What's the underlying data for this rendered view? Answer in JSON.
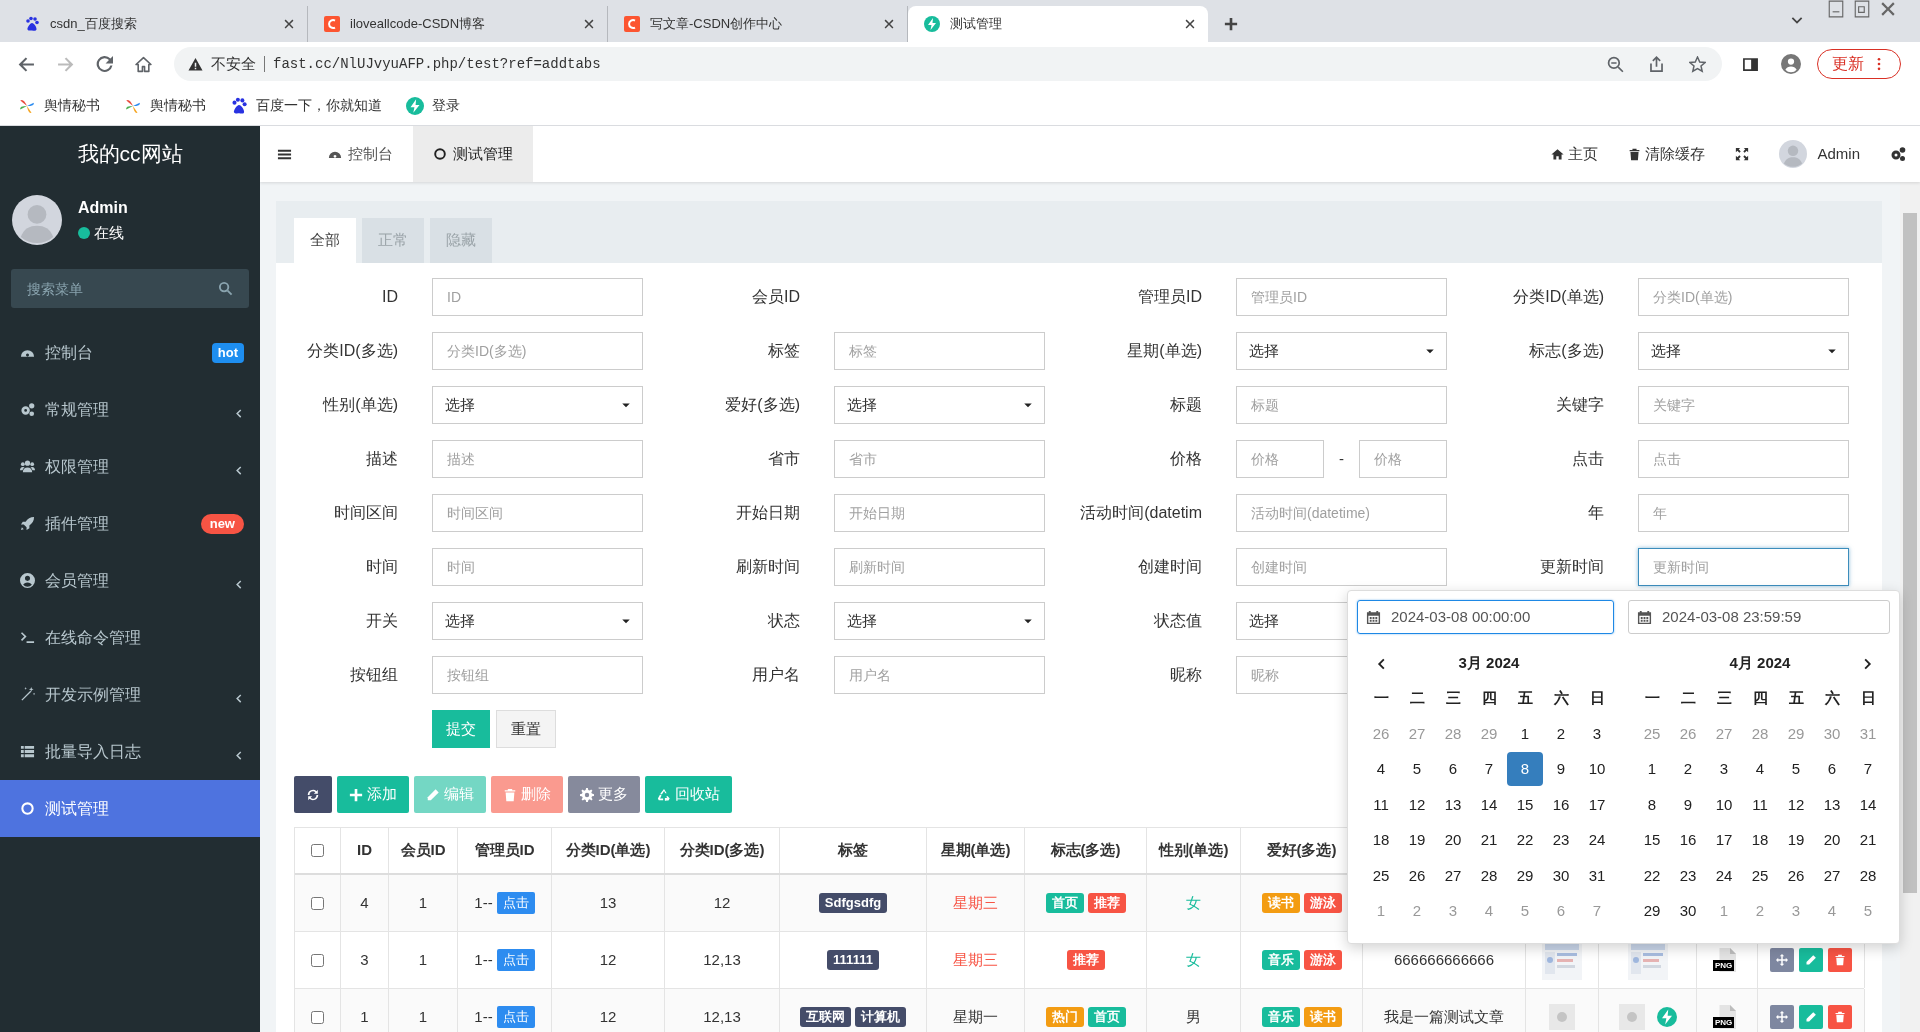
{
  "browser": {
    "tabs": [
      {
        "title": "csdn_百度搜索",
        "kind": "paw",
        "selected": false
      },
      {
        "title": "iloveallcode-CSDN博客",
        "kind": "csdn",
        "selected": false
      },
      {
        "title": "写文章-CSDN创作中心",
        "kind": "csdn",
        "selected": false
      },
      {
        "title": "测试管理",
        "kind": "bolt",
        "selected": true
      }
    ],
    "security": "不安全",
    "url": "fast.cc/NlUJvyuAFP.php/test?ref=addtabs",
    "update_button": "更新",
    "bookmarks": [
      {
        "label": "舆情秘书",
        "kind": "pinwheel"
      },
      {
        "label": "舆情秘书",
        "kind": "pinwheel"
      },
      {
        "label": "百度一下，你就知道",
        "kind": "paw"
      },
      {
        "label": "登录",
        "kind": "bolt"
      }
    ]
  },
  "sidebar": {
    "title": "我的cc网站",
    "user": {
      "name": "Admin",
      "status": "在线"
    },
    "search": {
      "placeholder": "搜索菜单"
    },
    "items": [
      {
        "label": "控制台",
        "kind": "dashboard",
        "badge": {
          "text": "hot",
          "color": "#1e8ef0"
        },
        "expandable": false,
        "selected": false
      },
      {
        "label": "常规管理",
        "kind": "cogs",
        "expandable": true,
        "selected": false
      },
      {
        "label": "权限管理",
        "kind": "users",
        "expandable": true,
        "selected": false
      },
      {
        "label": "插件管理",
        "kind": "rocket",
        "badge": {
          "text": "new",
          "color": "#f75444"
        },
        "expandable": false,
        "selected": false
      },
      {
        "label": "会员管理",
        "kind": "usercircle",
        "expandable": true,
        "selected": false
      },
      {
        "label": "在线命令管理",
        "kind": "terminal",
        "expandable": false,
        "selected": false
      },
      {
        "label": "开发示例管理",
        "kind": "magic",
        "expandable": true,
        "selected": false
      },
      {
        "label": "批量导入日志",
        "kind": "list",
        "expandable": true,
        "selected": false
      },
      {
        "label": "测试管理",
        "kind": "circle",
        "expandable": false,
        "selected": true
      }
    ]
  },
  "header": {
    "nav_tabs": [
      {
        "label": "控制台",
        "kind": "dashboard",
        "selected": false
      },
      {
        "label": "测试管理",
        "kind": "circle",
        "selected": true
      }
    ],
    "links": [
      {
        "label": "主页",
        "kind": "home"
      },
      {
        "label": "清除缓存",
        "kind": "trash"
      }
    ],
    "user": "Admin"
  },
  "panel": {
    "tabs": [
      {
        "label": "全部",
        "selected": true
      },
      {
        "label": "正常",
        "selected": false
      },
      {
        "label": "隐藏",
        "selected": false
      }
    ],
    "form": {
      "rows": [
        [
          {
            "label": "ID",
            "kind": "input",
            "placeholder": "ID",
            "focused": false
          },
          {
            "label": "会员ID",
            "kind": "none"
          },
          {
            "label": "管理员ID",
            "kind": "input",
            "placeholder": "管理员ID",
            "focused": false
          },
          {
            "label": "分类ID(单选)",
            "kind": "input",
            "placeholder": "分类ID(单选)",
            "focused": false
          }
        ],
        [
          {
            "label": "分类ID(多选)",
            "kind": "input",
            "placeholder": "分类ID(多选)",
            "focused": false
          },
          {
            "label": "标签",
            "kind": "input",
            "placeholder": "标签",
            "focused": false
          },
          {
            "label": "星期(单选)",
            "kind": "select",
            "value": "选择"
          },
          {
            "label": "标志(多选)",
            "kind": "select",
            "value": "选择"
          }
        ],
        [
          {
            "label": "性别(单选)",
            "kind": "select",
            "value": "选择"
          },
          {
            "label": "爱好(多选)",
            "kind": "select",
            "value": "选择"
          },
          {
            "label": "标题",
            "kind": "input",
            "placeholder": "标题",
            "focused": false
          },
          {
            "label": "关键字",
            "kind": "input",
            "placeholder": "关键字",
            "focused": false
          }
        ],
        [
          {
            "label": "描述",
            "kind": "input",
            "placeholder": "描述",
            "focused": false
          },
          {
            "label": "省市",
            "kind": "input",
            "placeholder": "省市",
            "focused": false
          },
          {
            "label": "价格",
            "kind": "range",
            "placeholder": "价格",
            "placeholder_to": "价格",
            "separator": "-"
          },
          {
            "label": "点击",
            "kind": "input",
            "placeholder": "点击",
            "focused": false
          }
        ],
        [
          {
            "label": "时间区间",
            "kind": "input",
            "placeholder": "时间区间",
            "focused": false
          },
          {
            "label": "开始日期",
            "kind": "input",
            "placeholder": "开始日期",
            "focused": false
          },
          {
            "label": "活动时间(datetim",
            "kind": "input",
            "placeholder": "活动时间(datetime)",
            "focused": false
          },
          {
            "label": "年",
            "kind": "input",
            "placeholder": "年",
            "focused": false
          }
        ],
        [
          {
            "label": "时间",
            "kind": "input",
            "placeholder": "时间",
            "focused": false
          },
          {
            "label": "刷新时间",
            "kind": "input",
            "placeholder": "刷新时间",
            "focused": false
          },
          {
            "label": "创建时间",
            "kind": "input",
            "placeholder": "创建时间",
            "focused": false
          },
          {
            "label": "更新时间",
            "kind": "input",
            "placeholder": "更新时间",
            "focused": true
          }
        ],
        [
          {
            "label": "开关",
            "kind": "select",
            "value": "选择"
          },
          {
            "label": "状态",
            "kind": "select",
            "value": "选择"
          },
          {
            "label": "状态值",
            "kind": "select",
            "value": "选择"
          }
        ],
        [
          {
            "label": "按钮组",
            "kind": "input",
            "placeholder": "按钮组",
            "focused": false
          },
          {
            "label": "用户名",
            "kind": "input",
            "placeholder": "用户名",
            "focused": false
          },
          {
            "label": "昵称",
            "kind": "input",
            "placeholder": "昵称",
            "focused": false
          }
        ]
      ],
      "submit": "提交",
      "reset": "重置"
    },
    "toolbar": [
      {
        "kind": "refresh",
        "disabled": false
      },
      {
        "kind": "add",
        "label": "添加",
        "disabled": false
      },
      {
        "kind": "edit",
        "label": "编辑",
        "disabled": true
      },
      {
        "kind": "delete",
        "label": "删除",
        "disabled": true
      },
      {
        "kind": "more",
        "label": "更多",
        "disabled": false
      },
      {
        "kind": "recycle",
        "label": "回收站",
        "disabled": false
      }
    ],
    "table": {
      "select_all_checked": false,
      "columns": [
        "ID",
        "会员ID",
        "管理员ID",
        "分类ID(单选)",
        "分类ID(多选)",
        "标签",
        "星期(单选)",
        "标志(多选)",
        "性别(单选)",
        "爱好(多选)"
      ],
      "rows": [
        {
          "checked": false,
          "id": "4",
          "member_id": "1",
          "admin_id": "1--",
          "admin_button": "点击",
          "category": "13",
          "categories": "12",
          "tags": [
            "Sdfgsdfg"
          ],
          "weekday": {
            "text": "星期三",
            "color": "#f75444"
          },
          "flags": [
            {
              "text": "首页",
              "color": "#18bc9c"
            },
            {
              "text": "推荐",
              "color": "#f75444"
            }
          ],
          "gender": {
            "text": "女",
            "color": "#18bc9c"
          },
          "hobbies": [
            {
              "text": "读书",
              "color": "#f39c12"
            },
            {
              "text": "游泳",
              "color": "#f75444"
            }
          ]
        },
        {
          "checked": false,
          "id": "3",
          "member_id": "1",
          "admin_id": "1--",
          "admin_button": "点击",
          "category": "12",
          "categories": "12,13",
          "tags": [
            "111111"
          ],
          "weekday": {
            "text": "星期三",
            "color": "#f75444"
          },
          "flags": [
            {
              "text": "推荐",
              "color": "#f75444"
            }
          ],
          "gender": {
            "text": "女",
            "color": "#18bc9c"
          },
          "hobbies": [
            {
              "text": "音乐",
              "color": "#18bc9c"
            },
            {
              "text": "游泳",
              "color": "#f75444"
            }
          ],
          "summary": "666666666666",
          "thumbnails": [
            {
              "kind": "picture"
            },
            {
              "kind": "picture"
            }
          ],
          "file_type": "PNG"
        },
        {
          "checked": false,
          "id": "1",
          "member_id": "1",
          "admin_id": "1--",
          "admin_button": "点击",
          "category": "12",
          "categories": "12,13",
          "tags": [
            "互联网",
            "计算机"
          ],
          "weekday": {
            "text": "星期一",
            "color": "#333333"
          },
          "flags": [
            {
              "text": "热门",
              "color": "#f39c12"
            },
            {
              "text": "首页",
              "color": "#18bc9c"
            }
          ],
          "gender": {
            "text": "男",
            "color": "#333333"
          },
          "hobbies": [
            {
              "text": "音乐",
              "color": "#18bc9c"
            },
            {
              "text": "读书",
              "color": "#f39c12"
            }
          ],
          "summary": "我是一篇测试文章",
          "thumbnails": [
            {
              "kind": "blank"
            },
            {
              "kind": "bolt"
            }
          ],
          "file_type": "PNG"
        }
      ]
    }
  },
  "date_picker": {
    "start": {
      "value": "2024-03-08 00:00:00",
      "focused": true
    },
    "end": {
      "value": "2024-03-08 23:59:59",
      "focused": false
    },
    "months": [
      {
        "title": "3月 2024",
        "weekdays": [
          "一",
          "二",
          "三",
          "四",
          "五",
          "六",
          "日"
        ],
        "days": [
          {
            "text": "26",
            "muted": true,
            "selected": false
          },
          {
            "text": "27",
            "muted": true,
            "selected": false
          },
          {
            "text": "28",
            "muted": true,
            "selected": false
          },
          {
            "text": "29",
            "muted": true,
            "selected": false
          },
          {
            "text": "1",
            "muted": false,
            "selected": false
          },
          {
            "text": "2",
            "muted": false,
            "selected": false
          },
          {
            "text": "3",
            "muted": false,
            "selected": false
          },
          {
            "text": "4",
            "muted": false,
            "selected": false
          },
          {
            "text": "5",
            "muted": false,
            "selected": false
          },
          {
            "text": "6",
            "muted": false,
            "selected": false
          },
          {
            "text": "7",
            "muted": false,
            "selected": false
          },
          {
            "text": "8",
            "muted": false,
            "selected": true
          },
          {
            "text": "9",
            "muted": false,
            "selected": false
          },
          {
            "text": "10",
            "muted": false,
            "selected": false
          },
          {
            "text": "11",
            "muted": false,
            "selected": false
          },
          {
            "text": "12",
            "muted": false,
            "selected": false
          },
          {
            "text": "13",
            "muted": false,
            "selected": false
          },
          {
            "text": "14",
            "muted": false,
            "selected": false
          },
          {
            "text": "15",
            "muted": false,
            "selected": false
          },
          {
            "text": "16",
            "muted": false,
            "selected": false
          },
          {
            "text": "17",
            "muted": false,
            "selected": false
          },
          {
            "text": "18",
            "muted": false,
            "selected": false
          },
          {
            "text": "19",
            "muted": false,
            "selected": false
          },
          {
            "text": "20",
            "muted": false,
            "selected": false
          },
          {
            "text": "21",
            "muted": false,
            "selected": false
          },
          {
            "text": "22",
            "muted": false,
            "selected": false
          },
          {
            "text": "23",
            "muted": false,
            "selected": false
          },
          {
            "text": "24",
            "muted": false,
            "selected": false
          },
          {
            "text": "25",
            "muted": false,
            "selected": false
          },
          {
            "text": "26",
            "muted": false,
            "selected": false
          },
          {
            "text": "27",
            "muted": false,
            "selected": false
          },
          {
            "text": "28",
            "muted": false,
            "selected": false
          },
          {
            "text": "29",
            "muted": false,
            "selected": false
          },
          {
            "text": "30",
            "muted": false,
            "selected": false
          },
          {
            "text": "31",
            "muted": false,
            "selected": false
          },
          {
            "text": "1",
            "muted": true,
            "selected": false
          },
          {
            "text": "2",
            "muted": true,
            "selected": false
          },
          {
            "text": "3",
            "muted": true,
            "selected": false
          },
          {
            "text": "4",
            "muted": true,
            "selected": false
          },
          {
            "text": "5",
            "muted": true,
            "selected": false
          },
          {
            "text": "6",
            "muted": true,
            "selected": false
          },
          {
            "text": "7",
            "muted": true,
            "selected": false
          }
        ]
      },
      {
        "title": "4月 2024",
        "weekdays": [
          "一",
          "二",
          "三",
          "四",
          "五",
          "六",
          "日"
        ],
        "days": [
          {
            "text": "25",
            "muted": true,
            "selected": false
          },
          {
            "text": "26",
            "muted": true,
            "selected": false
          },
          {
            "text": "27",
            "muted": true,
            "selected": false
          },
          {
            "text": "28",
            "muted": true,
            "selected": false
          },
          {
            "text": "29",
            "muted": true,
            "selected": false
          },
          {
            "text": "30",
            "muted": true,
            "selected": false
          },
          {
            "text": "31",
            "muted": true,
            "selected": false
          },
          {
            "text": "1",
            "muted": false,
            "selected": false
          },
          {
            "text": "2",
            "muted": false,
            "selected": false
          },
          {
            "text": "3",
            "muted": false,
            "selected": false
          },
          {
            "text": "4",
            "muted": false,
            "selected": false
          },
          {
            "text": "5",
            "muted": false,
            "selected": false
          },
          {
            "text": "6",
            "muted": false,
            "selected": false
          },
          {
            "text": "7",
            "muted": false,
            "selected": false
          },
          {
            "text": "8",
            "muted": false,
            "selected": false
          },
          {
            "text": "9",
            "muted": false,
            "selected": false
          },
          {
            "text": "10",
            "muted": false,
            "selected": false
          },
          {
            "text": "11",
            "muted": false,
            "selected": false
          },
          {
            "text": "12",
            "muted": false,
            "selected": false
          },
          {
            "text": "13",
            "muted": false,
            "selected": false
          },
          {
            "text": "14",
            "muted": false,
            "selected": false
          },
          {
            "text": "15",
            "muted": false,
            "selected": false
          },
          {
            "text": "16",
            "muted": false,
            "selected": false
          },
          {
            "text": "17",
            "muted": false,
            "selected": false
          },
          {
            "text": "18",
            "muted": false,
            "selected": false
          },
          {
            "text": "19",
            "muted": false,
            "selected": false
          },
          {
            "text": "20",
            "muted": false,
            "selected": false
          },
          {
            "text": "21",
            "muted": false,
            "selected": false
          },
          {
            "text": "22",
            "muted": false,
            "selected": false
          },
          {
            "text": "23",
            "muted": false,
            "selected": false
          },
          {
            "text": "24",
            "muted": false,
            "selected": false
          },
          {
            "text": "25",
            "muted": false,
            "selected": false
          },
          {
            "text": "26",
            "muted": false,
            "selected": false
          },
          {
            "text": "27",
            "muted": false,
            "selected": false
          },
          {
            "text": "28",
            "muted": false,
            "selected": false
          },
          {
            "text": "29",
            "muted": false,
            "selected": false
          },
          {
            "text": "30",
            "muted": false,
            "selected": false
          },
          {
            "text": "1",
            "muted": true,
            "selected": false
          },
          {
            "text": "2",
            "muted": true,
            "selected": false
          },
          {
            "text": "3",
            "muted": true,
            "selected": false
          },
          {
            "text": "4",
            "muted": true,
            "selected": false
          },
          {
            "text": "5",
            "muted": true,
            "selected": false
          }
        ]
      }
    ]
  }
}
